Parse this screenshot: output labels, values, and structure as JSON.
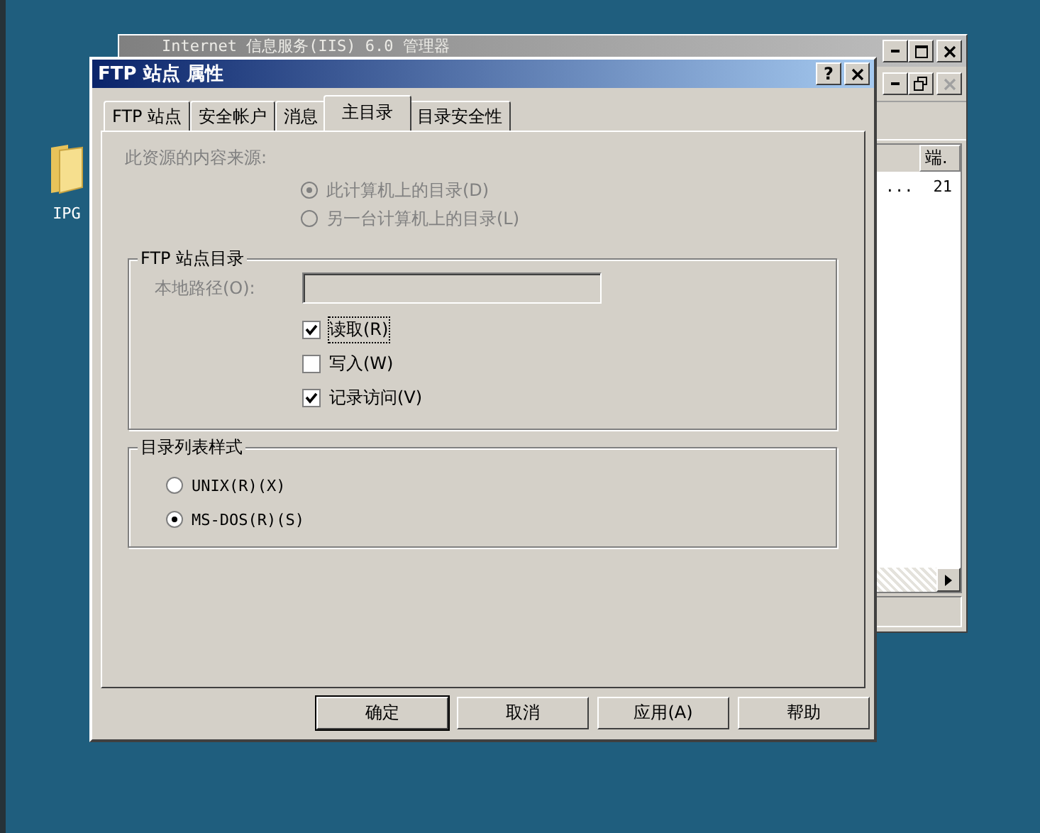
{
  "desktop_icons": [
    {
      "label": "IPG"
    }
  ],
  "back_window": {
    "title": "Internet 信息服务(IIS) 6.0 管理器",
    "list": {
      "column_header": "端.",
      "rows": [
        {
          "column_1": "...",
          "column_2": "21"
        }
      ]
    }
  },
  "dialog": {
    "title": "FTP 站点 属性",
    "help_glyph": "?",
    "tabs": [
      {
        "label": "FTP 站点",
        "selected": false
      },
      {
        "label": "安全帐户",
        "selected": false
      },
      {
        "label": "消息",
        "selected": false
      },
      {
        "label": "主目录",
        "selected": true
      },
      {
        "label": "目录安全性",
        "selected": false
      }
    ],
    "source_label": "此资源的内容来源:",
    "source_options": [
      {
        "label": "此计算机上的目录(D)",
        "selected": true,
        "disabled": true
      },
      {
        "label": "另一台计算机上的目录(L)",
        "selected": false,
        "disabled": true
      }
    ],
    "ftp_directory": {
      "title": "FTP 站点目录",
      "path_label": "本地路径(O):",
      "path_disabled": true,
      "checkboxes": [
        {
          "label": "读取(R)",
          "checked": true
        },
        {
          "label": "写入(W)",
          "checked": false
        },
        {
          "label": "记录访问(V)",
          "checked": true
        }
      ]
    },
    "listing_style": {
      "title": "目录列表样式",
      "options": [
        {
          "label": "UNIX(R)(X)",
          "selected": false
        },
        {
          "label": "MS-DOS(R)(S)",
          "selected": true
        }
      ]
    },
    "buttons": [
      {
        "label": "确定",
        "default": true
      },
      {
        "label": "取消",
        "default": false
      },
      {
        "label": "应用(A)",
        "default": false
      },
      {
        "label": "帮助",
        "default": false
      }
    ]
  }
}
